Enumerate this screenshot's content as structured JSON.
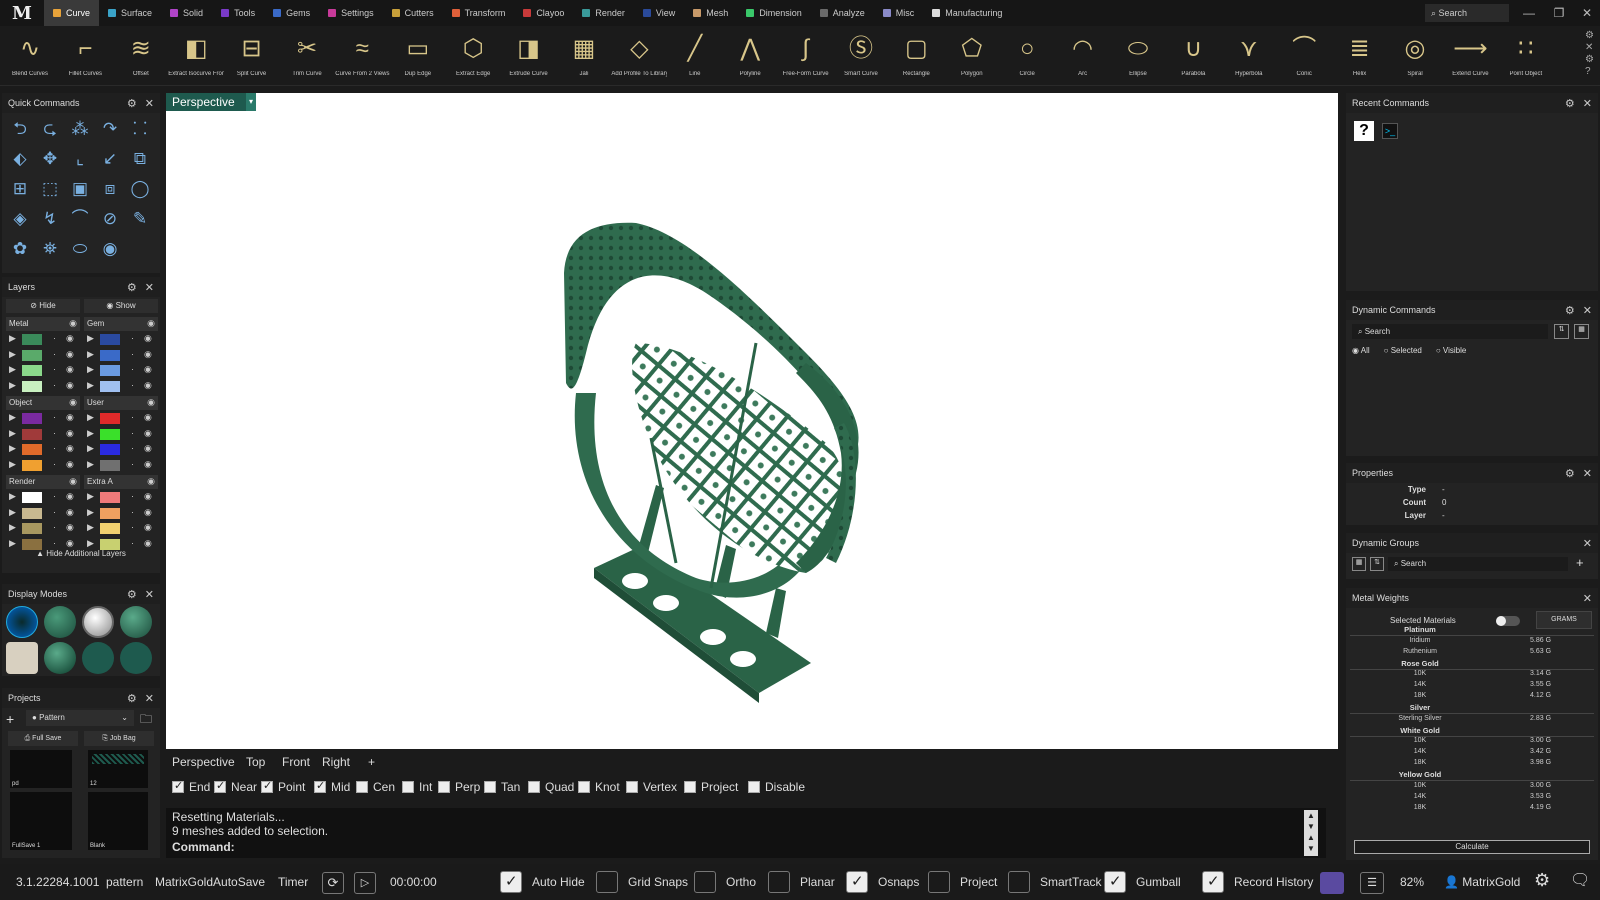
{
  "app": {
    "logo": "M"
  },
  "menu": {
    "tabs": [
      {
        "label": "Curve",
        "color": "#e8a33a",
        "active": true
      },
      {
        "label": "Surface",
        "color": "#3aa3c8"
      },
      {
        "label": "Solid",
        "color": "#b044c8"
      },
      {
        "label": "Tools",
        "color": "#7a3ac8"
      },
      {
        "label": "Gems",
        "color": "#3a6ac8"
      },
      {
        "label": "Settings",
        "color": "#c83a9a"
      },
      {
        "label": "Cutters",
        "color": "#c8a03a"
      },
      {
        "label": "Transform",
        "color": "#e0603a"
      },
      {
        "label": "Clayoo",
        "color": "#c83a3a"
      },
      {
        "label": "Render",
        "color": "#3a9a9a"
      },
      {
        "label": "View",
        "color": "#2a4a9a"
      },
      {
        "label": "Mesh",
        "color": "#c89a6a"
      },
      {
        "label": "Dimension",
        "color": "#3ac86a"
      },
      {
        "label": "Analyze",
        "color": "#6a6a6a"
      },
      {
        "label": "Misc",
        "color": "#8a8ac8"
      },
      {
        "label": "Manufacturing",
        "color": "#dddddd"
      }
    ],
    "search_placeholder": "Search"
  },
  "ribbon": {
    "buttons": [
      "Blend Curves",
      "Fillet Curves",
      "Offset",
      "Extract Isocurve From...",
      "Split Curve",
      "Trim Curve",
      "Curve From 2 Views",
      "Dup Edge",
      "Extract Edge",
      "Extrude Curve",
      "Jali",
      "Add Profile To Library",
      "Line",
      "Polyline",
      "Free-Form Curve",
      "Smart Curve",
      "Rectangle",
      "Polygon",
      "Circle",
      "Arc",
      "Ellipse",
      "Parabola",
      "Hyperbola",
      "Conic",
      "Helix",
      "Spiral",
      "Extend Curve",
      "Point Object"
    ]
  },
  "quick_commands": {
    "title": "Quick Commands"
  },
  "layers": {
    "title": "Layers",
    "hide_label": "Hide",
    "show_label": "Show",
    "groups": [
      {
        "name": "Metal",
        "colors": [
          "#3a8a5a",
          "#5aaa6a",
          "#8ad88a",
          "#c8f0c0"
        ]
      },
      {
        "name": "Gem",
        "colors": [
          "#2a4aa0",
          "#3a6ac8",
          "#6a9ae0",
          "#a0c0f0"
        ]
      },
      {
        "name": "Object",
        "colors": [
          "#7a2aa0",
          "#a03a3a",
          "#e06a2a",
          "#f0a030"
        ]
      },
      {
        "name": "User",
        "colors": [
          "#e02a2a",
          "#3ae02a",
          "#2a2ae0",
          "#707070"
        ]
      },
      {
        "name": "Render",
        "colors": [
          "#ffffff",
          "#c8b890",
          "#a89860",
          "#8a7040"
        ]
      },
      {
        "name": "Extra A",
        "colors": [
          "#f07a7a",
          "#f0a060",
          "#f0d070",
          "#c8d070"
        ]
      }
    ],
    "footer": "Hide Additional Layers"
  },
  "display_modes": {
    "title": "Display Modes"
  },
  "projects": {
    "title": "Projects",
    "selected": "Pattern",
    "full_save": "Full Save",
    "job_bag": "Job Bag",
    "thumbs": [
      "pd",
      "12",
      "FullSave 1",
      "Blank"
    ]
  },
  "viewport": {
    "active_view": "Perspective",
    "tabs": [
      "Perspective",
      "Top",
      "Front",
      "Right"
    ],
    "add_tab": "+"
  },
  "osnaps": [
    {
      "label": "End",
      "on": true
    },
    {
      "label": "Near",
      "on": true
    },
    {
      "label": "Point",
      "on": true
    },
    {
      "label": "Mid",
      "on": true
    },
    {
      "label": "Cen",
      "on": false
    },
    {
      "label": "Int",
      "on": false
    },
    {
      "label": "Perp",
      "on": false
    },
    {
      "label": "Tan",
      "on": false
    },
    {
      "label": "Quad",
      "on": false
    },
    {
      "label": "Knot",
      "on": false
    },
    {
      "label": "Vertex",
      "on": false
    },
    {
      "label": "Project",
      "on": false
    },
    {
      "label": "Disable",
      "on": false
    }
  ],
  "command": {
    "history": [
      "Resetting Materials...",
      "9 meshes added to selection."
    ],
    "prompt": "Command:"
  },
  "status": {
    "version": "3.1.22284.1001",
    "project": "pattern",
    "autosave": "MatrixGoldAutoSave",
    "timer_label": "Timer",
    "timer_value": "00:00:00",
    "toggles": [
      {
        "label": "Auto Hide",
        "on": true
      },
      {
        "label": "Grid Snaps",
        "on": false
      },
      {
        "label": "Ortho",
        "on": false
      },
      {
        "label": "Planar",
        "on": false
      },
      {
        "label": "Osnaps",
        "on": true
      },
      {
        "label": "Project",
        "on": false
      },
      {
        "label": "SmartTrack",
        "on": false
      },
      {
        "label": "Gumball",
        "on": true
      },
      {
        "label": "Record History",
        "on": true
      }
    ],
    "zoom": "82%",
    "user": "MatrixGold"
  },
  "recent_commands": {
    "title": "Recent Commands"
  },
  "dynamic_commands": {
    "title": "Dynamic Commands",
    "search_placeholder": "Search",
    "filters": [
      "All",
      "Selected",
      "Visible"
    ]
  },
  "properties": {
    "title": "Properties",
    "rows": [
      {
        "key": "Type",
        "value": "-"
      },
      {
        "key": "Count",
        "value": "0"
      },
      {
        "key": "Layer",
        "value": "-"
      }
    ]
  },
  "dynamic_groups": {
    "title": "Dynamic Groups",
    "search_placeholder": "Search"
  },
  "metal_weights": {
    "title": "Metal Weights",
    "selected_materials": "Selected Materials",
    "unit": "GRAMS",
    "sections": [
      {
        "name": "Platinum",
        "rows": [
          {
            "k": "Iridium",
            "v": "5.86 G"
          },
          {
            "k": "Ruthenium",
            "v": "5.63 G"
          }
        ]
      },
      {
        "name": "Rose Gold",
        "rows": [
          {
            "k": "10K",
            "v": "3.14 G"
          },
          {
            "k": "14K",
            "v": "3.55 G"
          },
          {
            "k": "18K",
            "v": "4.12 G"
          }
        ]
      },
      {
        "name": "Silver",
        "rows": [
          {
            "k": "Sterling Silver",
            "v": "2.83 G"
          }
        ]
      },
      {
        "name": "White Gold",
        "rows": [
          {
            "k": "10K",
            "v": "3.00 G"
          },
          {
            "k": "14K",
            "v": "3.42 G"
          },
          {
            "k": "18K",
            "v": "3.98 G"
          }
        ]
      },
      {
        "name": "Yellow Gold",
        "rows": [
          {
            "k": "10K",
            "v": "3.00 G"
          },
          {
            "k": "14K",
            "v": "3.53 G"
          },
          {
            "k": "18K",
            "v": "4.19 G"
          }
        ]
      }
    ],
    "calculate": "Calculate"
  }
}
